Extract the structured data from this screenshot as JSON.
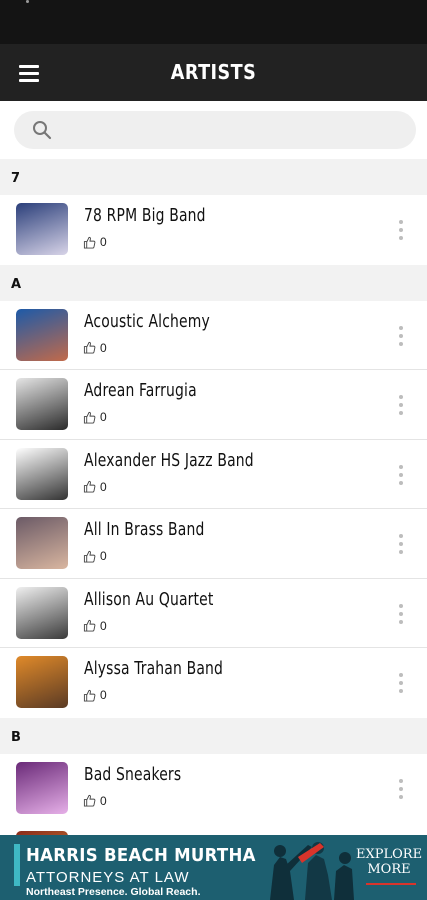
{
  "app": {
    "title": "ARTISTS"
  },
  "search": {
    "placeholder": ""
  },
  "sections": [
    {
      "letter": "7",
      "artists": [
        {
          "name": "78 RPM Big Band",
          "likes": "0",
          "thumb": [
            "#2b3f7a",
            "#d8d4e8"
          ]
        }
      ]
    },
    {
      "letter": "A",
      "artists": [
        {
          "name": "Acoustic Alchemy",
          "likes": "0",
          "thumb": [
            "#1d5aa8",
            "#c26a4a"
          ]
        },
        {
          "name": "Adrean Farrugia",
          "likes": "0",
          "thumb": [
            "#e6e6e6",
            "#2a2a2a"
          ]
        },
        {
          "name": "Alexander HS Jazz Band",
          "likes": "0",
          "thumb": [
            "#ffffff",
            "#333333"
          ]
        },
        {
          "name": "All In Brass Band",
          "likes": "0",
          "thumb": [
            "#6b5a66",
            "#d9b6a0"
          ]
        },
        {
          "name": "Allison Au Quartet",
          "likes": "0",
          "thumb": [
            "#f0f0f0",
            "#3a3a3a"
          ]
        },
        {
          "name": "Alyssa Trahan Band",
          "likes": "0",
          "thumb": [
            "#e08a2a",
            "#5a3a24"
          ]
        }
      ]
    },
    {
      "letter": "B",
      "artists": [
        {
          "name": "Bad Sneakers",
          "likes": "0",
          "thumb": [
            "#6a2a78",
            "#e6b0e8"
          ]
        }
      ]
    }
  ],
  "ad": {
    "line1": "HARRIS BEACH MURTHA",
    "line2": "ATTORNEYS AT LAW",
    "line3": "Northeast Presence. Global Reach.",
    "cta_line1": "EXPLORE",
    "cta_line2": "MORE",
    "accent_color": "#1d5f70"
  },
  "icons": {
    "menu": "hamburger-menu-icon",
    "search": "search-icon",
    "like": "thumbs-up-icon",
    "more": "more-vertical-icon"
  },
  "colors": {
    "status_bar": "#141414",
    "app_bar": "#222222",
    "section_header": "#f2f2f2",
    "search_bg": "#efefef"
  }
}
